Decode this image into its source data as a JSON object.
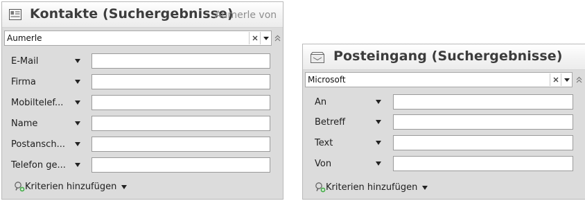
{
  "left_panel": {
    "title": "Kontakte (Suchergebnisse)",
    "subtitle": "Aumerle von",
    "icon": "contact-card-icon",
    "search": {
      "value": "Aumerle"
    },
    "fields": [
      {
        "label": "E-Mail"
      },
      {
        "label": "Firma"
      },
      {
        "label": "Mobiltelef..."
      },
      {
        "label": "Name"
      },
      {
        "label": "Postansch..."
      },
      {
        "label": "Telefon ge..."
      }
    ],
    "add_criteria": "Kriterien hinzufügen"
  },
  "right_panel": {
    "title": "Posteingang (Suchergebnisse)",
    "icon": "inbox-icon",
    "search": {
      "value": "Microsoft"
    },
    "fields": [
      {
        "label": "An"
      },
      {
        "label": "Betreff"
      },
      {
        "label": "Text"
      },
      {
        "label": "Von"
      }
    ],
    "add_criteria": "Kriterien hinzufügen"
  }
}
